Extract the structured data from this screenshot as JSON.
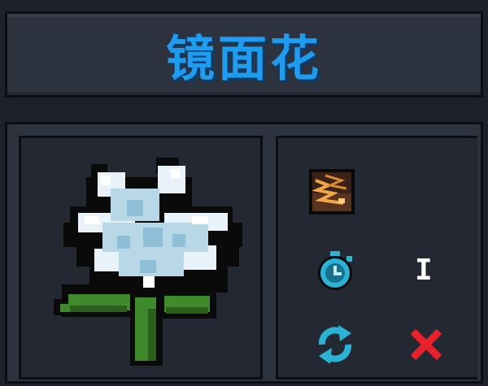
{
  "item": {
    "name": "镜面花",
    "icon": "mirror-flower-icon"
  },
  "stats": {
    "element_icon": "lightning-element-icon",
    "cooldown_icon": "stopwatch-icon",
    "cooldown_value": "I",
    "reuse_icon": "refresh-icon",
    "reuse_status_icon": "red-x-icon"
  },
  "colors": {
    "title": "#1f9bf0",
    "panel": "#2c333f",
    "slot": "#232833",
    "cross": "#e8212b",
    "cyan": "#2bb3d6"
  }
}
